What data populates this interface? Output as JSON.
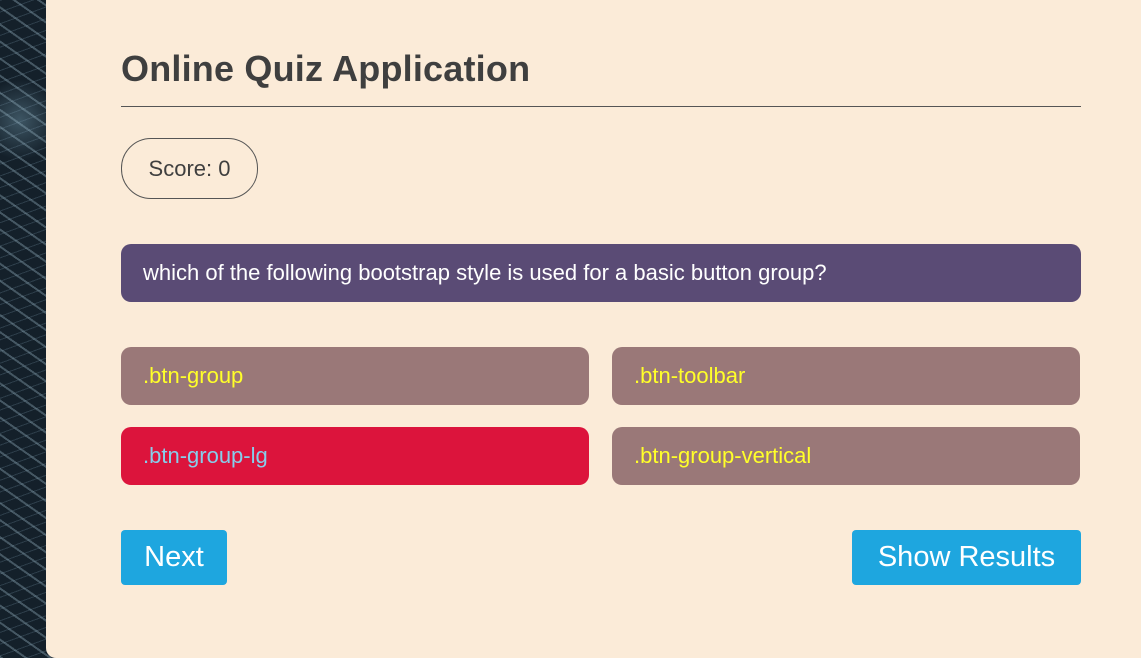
{
  "app": {
    "title": "Online Quiz Application"
  },
  "score": {
    "label": "Score: 0"
  },
  "question": {
    "text": "which of the following bootstrap style is used for a basic button group?"
  },
  "options": [
    {
      "label": ".btn-group",
      "state": "default"
    },
    {
      "label": ".btn-toolbar",
      "state": "default"
    },
    {
      "label": ".btn-group-lg",
      "state": "selected"
    },
    {
      "label": ".btn-group-vertical",
      "state": "default"
    }
  ],
  "actions": {
    "next_label": "Next",
    "results_label": "Show Results"
  },
  "colors": {
    "card_background": "#fbebd8",
    "question_background": "#5a4b75",
    "option_background": "#9a7878",
    "option_text": "#ffff29",
    "selected_background": "#dc143c",
    "selected_text": "#87ceeb",
    "button_background": "#1ea6df"
  }
}
